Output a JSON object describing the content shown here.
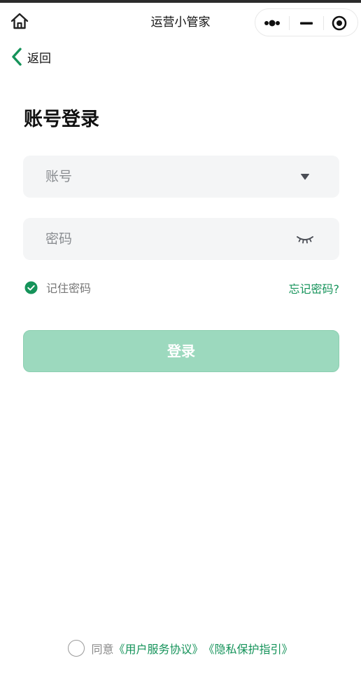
{
  "navbar": {
    "title": "运营小管家",
    "icons": {
      "home": "home-icon",
      "more": "more-dots-icon",
      "minimize": "minimize-icon",
      "close": "record-target-icon"
    }
  },
  "back": {
    "label": "返回",
    "icon": "chevron-left-icon"
  },
  "page": {
    "title": "账号登录"
  },
  "account": {
    "placeholder": "账号",
    "value": "",
    "icon": "caret-down-icon"
  },
  "password": {
    "placeholder": "密码",
    "value": "",
    "icon": "eye-closed-icon"
  },
  "remember": {
    "label": "记住密码",
    "checked": true,
    "icon": "check-circle-icon"
  },
  "forgot": {
    "label": "忘记密码?"
  },
  "login": {
    "label": "登录"
  },
  "agreement": {
    "checked": false,
    "prefix": "同意",
    "link_terms": "《用户服务协议》",
    "link_privacy": "《隐私保护指引》"
  },
  "colors": {
    "accent": "#15935a",
    "button_disabled": "#9cd9be",
    "field_bg": "#f4f5f6"
  }
}
